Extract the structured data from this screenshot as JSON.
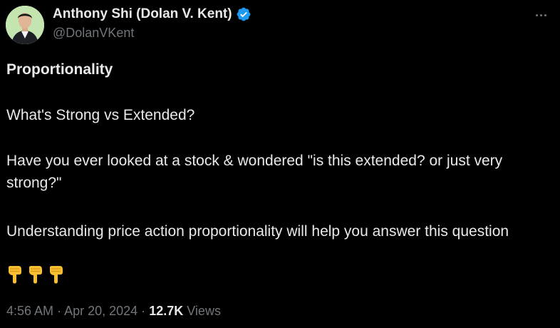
{
  "author": {
    "display_name": "Anthony Shi (Dolan V. Kent)",
    "handle": "@DolanVKent",
    "verified": true,
    "avatar_icon": "profile-photo"
  },
  "tweet": {
    "title": "Proportionality",
    "question": "What's Strong vs Extended?",
    "paragraph1": "Have you ever looked at a stock & wondered \"is this extended? or just very strong?\"",
    "paragraph2": "Understanding price action proportionality will help you answer this question",
    "emojis": [
      "backhand-index-pointing-down",
      "backhand-index-pointing-down",
      "backhand-index-pointing-down"
    ]
  },
  "meta": {
    "time": "4:56 AM",
    "separator": "·",
    "date": "Apr 20, 2024",
    "views_count": "12.7K",
    "views_label": "Views"
  },
  "colors": {
    "background": "#000000",
    "primary_text": "#e7e9ea",
    "secondary_text": "#71767b",
    "verified_blue": "#1d9bf0"
  }
}
